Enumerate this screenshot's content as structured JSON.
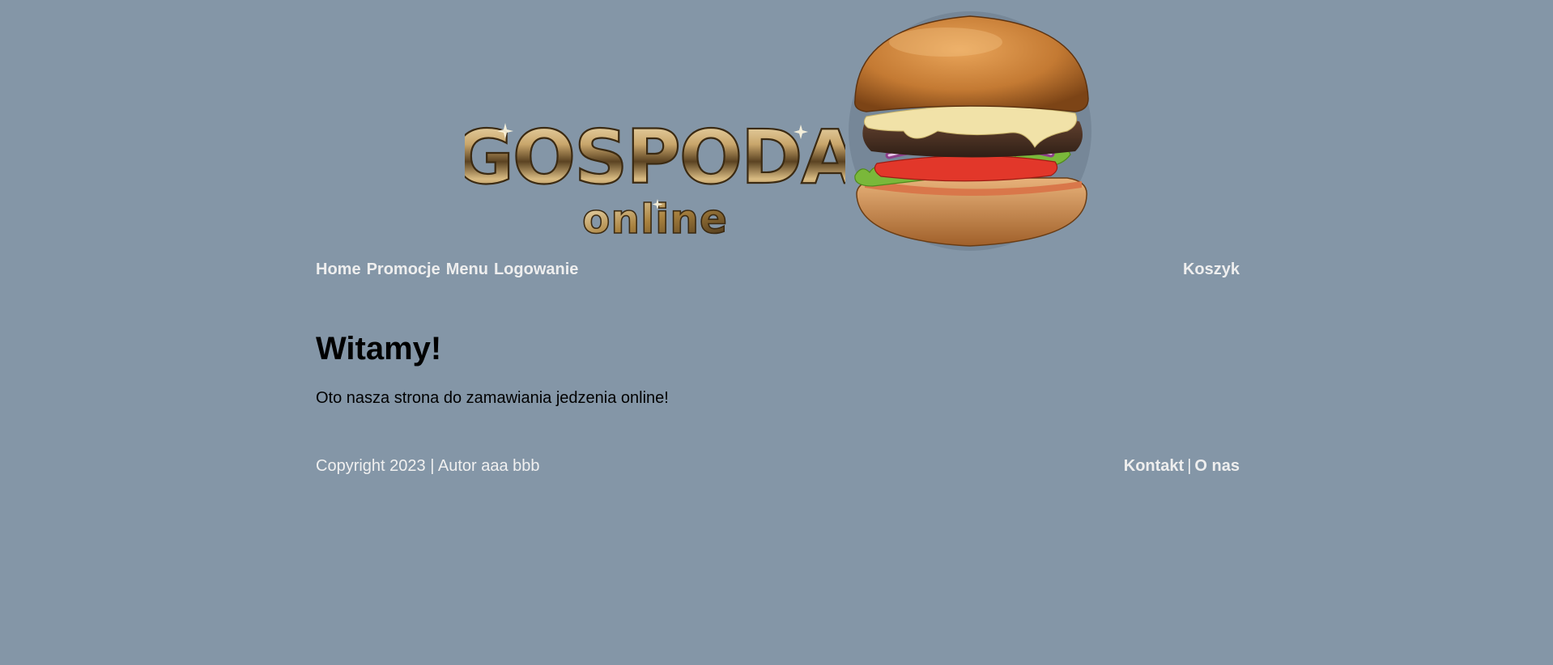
{
  "header": {
    "logo_text_main": "GOSPODA",
    "logo_text_sub": "online",
    "logo_icon": "burger-image"
  },
  "nav": {
    "items": [
      {
        "label": "Home"
      },
      {
        "label": "Promocje"
      },
      {
        "label": "Menu"
      },
      {
        "label": "Logowanie"
      }
    ],
    "cart_label": "Koszyk"
  },
  "main": {
    "title": "Witamy!",
    "text": "Oto nasza strona do zamawiania jedzenia online!"
  },
  "footer": {
    "copyright": "Copyright 2023 | Autor aaa bbb",
    "contact_label": "Kontakt",
    "separator": "|",
    "about_label": "O nas"
  },
  "colors": {
    "background": "#8496a7",
    "nav_text": "#eeeeee",
    "body_text": "#000000",
    "logo_gold": "#c9a66b"
  }
}
